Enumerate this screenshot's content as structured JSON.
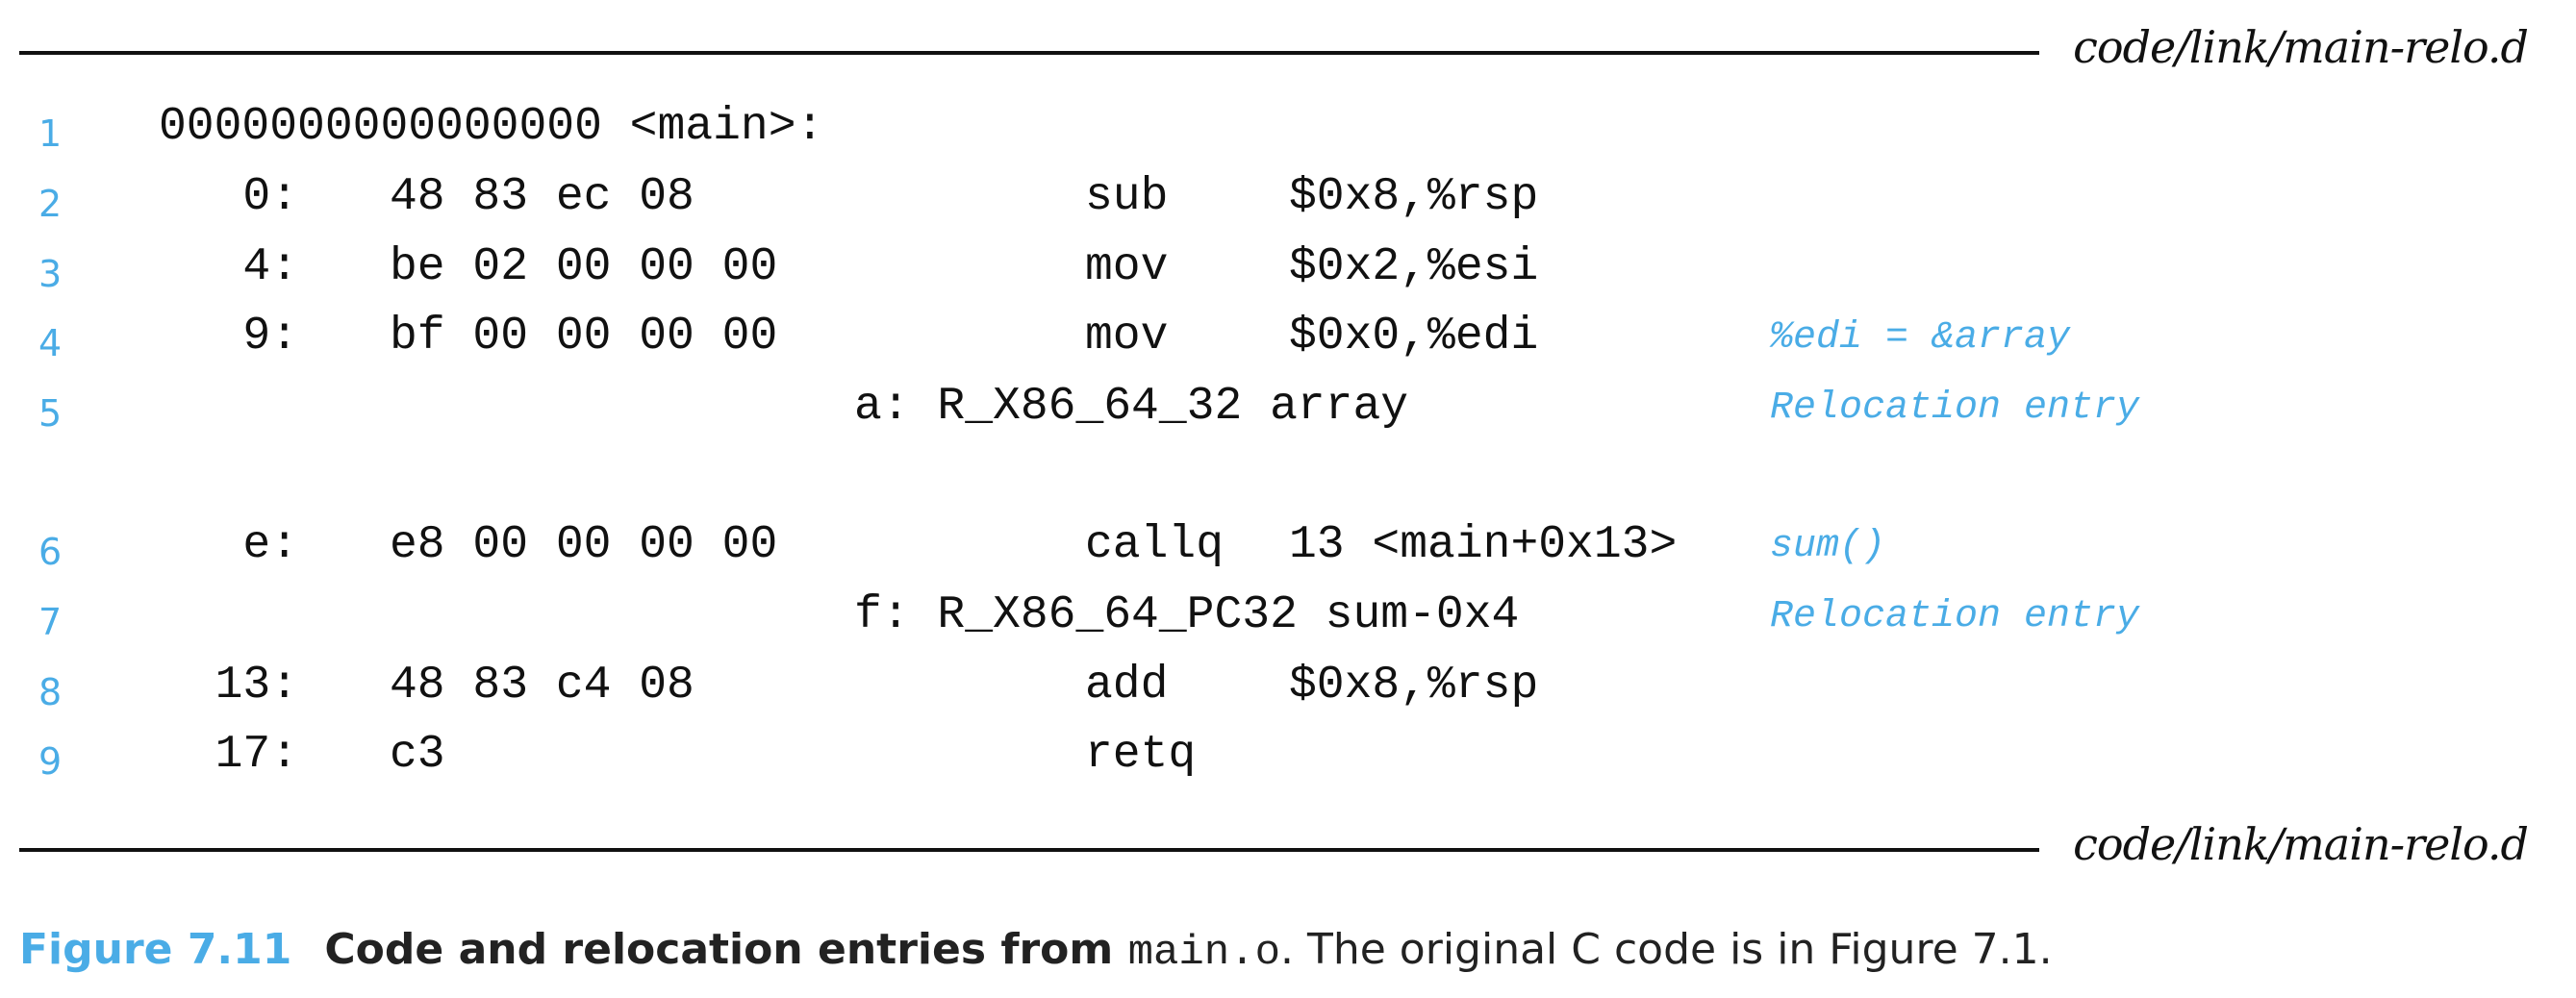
{
  "source_file": "code/link/main-relo.d",
  "listing": {
    "header": {
      "line": "1",
      "text": "0000000000000000 <main>:"
    },
    "instructions": [
      {
        "line": "2",
        "addr": "0:",
        "bytes": "48 83 ec 08",
        "mnemonic": "sub",
        "operands": "$0x8,%rsp",
        "comment": ""
      },
      {
        "line": "3",
        "addr": "4:",
        "bytes": "be 02 00 00 00",
        "mnemonic": "mov",
        "operands": "$0x2,%esi",
        "comment": ""
      },
      {
        "line": "4",
        "addr": "9:",
        "bytes": "bf 00 00 00 00",
        "mnemonic": "mov",
        "operands": "$0x0,%edi",
        "comment": "%edi = &array"
      },
      {
        "line": "5",
        "reloc": "a: R_X86_64_32 array",
        "comment": "Relocation entry"
      },
      {
        "line": "6",
        "addr": "e:",
        "bytes": "e8 00 00 00 00",
        "mnemonic": "callq",
        "operands": "13 <main+0x13>",
        "comment": "sum()"
      },
      {
        "line": "7",
        "reloc": "f: R_X86_64_PC32 sum-0x4",
        "comment": "Relocation entry"
      },
      {
        "line": "8",
        "addr": "13:",
        "bytes": "48 83 c4 08",
        "mnemonic": "add",
        "operands": "$0x8,%rsp",
        "comment": ""
      },
      {
        "line": "9",
        "addr": "17:",
        "bytes": "c3",
        "mnemonic": "retq",
        "operands": "",
        "comment": ""
      }
    ]
  },
  "caption": {
    "figure_label": "Figure 7.11",
    "bold_text": "Code and relocation entries from ",
    "code_text": "main.o",
    "rest_text": ". The original C code is in Figure 7.1."
  },
  "colors": {
    "accent": "#4aace6",
    "text": "#111111"
  }
}
